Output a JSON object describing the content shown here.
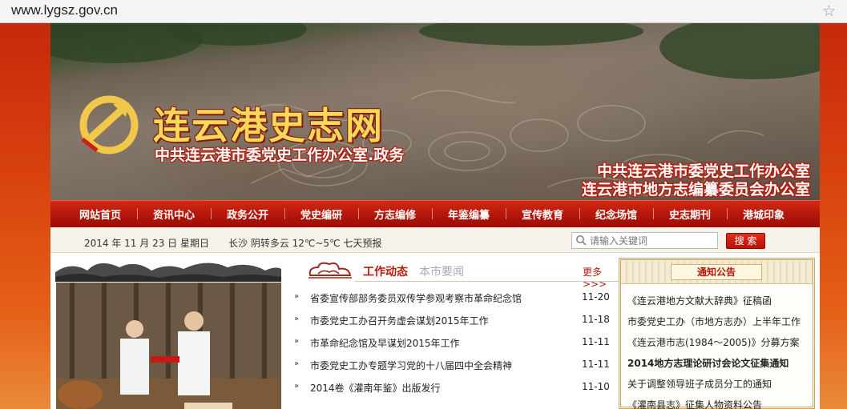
{
  "browser": {
    "url": "www.lygsz.gov.cn",
    "bookmark_icon": "star-icon"
  },
  "banner": {
    "site_title": "连云港史志网",
    "subtitle": "中共连云港市委党史工作办公室.政务",
    "office_line_1": "中共连云港市委党史工作办公室",
    "office_line_2": "连云港市地方志编纂委员会办公室",
    "emblem_icon": "party-emblem-icon"
  },
  "nav": {
    "items": [
      {
        "label": "网站首页"
      },
      {
        "label": "资讯中心"
      },
      {
        "label": "政务公开"
      },
      {
        "label": "党史编研"
      },
      {
        "label": "方志编修"
      },
      {
        "label": "年鉴编纂"
      },
      {
        "label": "宣传教育"
      },
      {
        "label": "纪念场馆"
      },
      {
        "label": "史志期刊"
      },
      {
        "label": "港城印象"
      }
    ]
  },
  "info": {
    "date": "2014 年 11 月 23 日 星期日",
    "weather": "长沙  阴转多云  12℃~5℃  七天预报"
  },
  "search": {
    "placeholder": "请输入关键词",
    "button_label": "搜 索",
    "icon": "search-icon"
  },
  "news": {
    "tab_active": "工作动态",
    "tab_inactive": "本市要闻",
    "more_label": "更多 >>>",
    "items": [
      {
        "title": "省委宣传部部务委员双传学参观考察市革命纪念馆",
        "date": "11-20"
      },
      {
        "title": "市委党史工办召开务虚会谋划2015年工作",
        "date": "11-18"
      },
      {
        "title": "市革命纪念馆及早谋划2015年工作",
        "date": "11-11"
      },
      {
        "title": "市委党史工办专题学习党的十八届四中全会精神",
        "date": "11-11"
      },
      {
        "title": "2014卷《灌南年鉴》出版发行",
        "date": "11-10"
      }
    ]
  },
  "notice": {
    "title": "通知公告",
    "items": [
      {
        "text": "《连云港地方文献大辞典》征稿函"
      },
      {
        "text": "市委党史工办（市地方志办）上半年工作"
      },
      {
        "text": "《连云港市志(1984～2005)》分募方案"
      },
      {
        "text": "2014地方志理论研讨会论文征集通知"
      },
      {
        "text": "关于调整领导班子成员分工的通知"
      },
      {
        "text": "《灌南县志》征集人物资料公告"
      }
    ]
  },
  "colors": {
    "brand_red": "#b3150a",
    "title_gold": "#f6d85a",
    "accent_text": "#b51a08"
  }
}
